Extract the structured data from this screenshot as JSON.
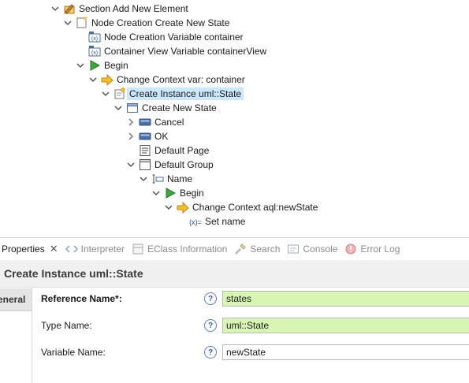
{
  "tree": {
    "section_add": "Section Add New Element",
    "node_creation": "Node Creation Create New State",
    "var_container": "Node Creation Variable container",
    "var_container_view": "Container View Variable containerView",
    "begin1": "Begin",
    "change_context1": "Change Context var: container",
    "create_instance": "Create Instance uml::State",
    "create_new_state": "Create New State",
    "cancel": "Cancel",
    "ok": "OK",
    "default_page": "Default Page",
    "default_group": "Default Group",
    "name": "Name",
    "begin2": "Begin",
    "change_context2": "Change Context aql:newState",
    "set_name": "Set name"
  },
  "tabs": {
    "properties": "Properties",
    "interpreter": "Interpreter",
    "eclass_info": "EClass Information",
    "search": "Search",
    "console": "Console",
    "error_log": "Error Log"
  },
  "form": {
    "title": "Create Instance uml::State",
    "side_tab": "eneral",
    "rows": [
      {
        "label": "Reference Name*:",
        "value": "states"
      },
      {
        "label": "Type Name:",
        "value": "uml::State"
      },
      {
        "label": "Variable Name:",
        "value": "newState"
      }
    ],
    "help_glyph": "?"
  },
  "colors": {
    "selection": "#cce8ff",
    "required_field": "#d8f5b4",
    "help_icon": "#2d5aa8"
  }
}
